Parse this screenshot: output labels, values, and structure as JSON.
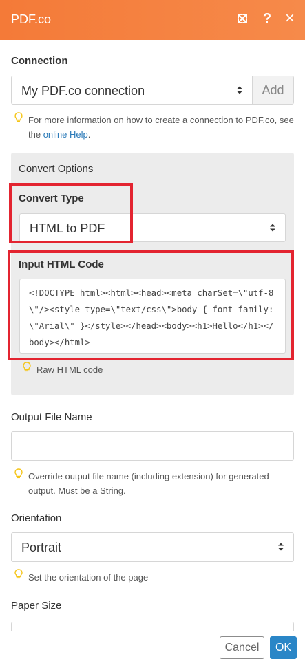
{
  "header": {
    "title": "PDF.co",
    "icons": [
      "expand-icon",
      "help-icon",
      "close-icon"
    ],
    "help_glyph": "?",
    "close_glyph": "×",
    "bg_color": "#f47a38"
  },
  "connection": {
    "label": "Connection",
    "selected": "My PDF.co connection",
    "add_label": "Add",
    "hint_text": "For more information on how to create a connection to PDF.co, see the",
    "hint_link": "online Help",
    "hint_end": "."
  },
  "convert_options": {
    "title": "Convert Options",
    "convert_type": {
      "label": "Convert Type",
      "selected": "HTML to PDF"
    },
    "input_html": {
      "label": "Input HTML Code",
      "value": "<!DOCTYPE html><html><head><meta charSet=\\\"utf-8\\\"/><style type=\\\"text/css\\\">body { font-family: \\\"Arial\\\" }</style></head><body><h1>Hello</h1></body></html>",
      "hint": "Raw HTML code"
    }
  },
  "output_file_name": {
    "label": "Output File Name",
    "value": "",
    "hint": "Override output file name (including extension) for generated output. Must be a String."
  },
  "orientation": {
    "label": "Orientation",
    "selected": "Portrait",
    "hint": "Set the orientation of the page"
  },
  "paper_size": {
    "label": "Paper Size"
  },
  "footer": {
    "cancel_label": "Cancel",
    "ok_label": "OK",
    "ok_color": "#2a86c7"
  },
  "colors": {
    "highlight": "#e32430",
    "link": "#2a7ab8",
    "bulb": "#f5c518"
  }
}
